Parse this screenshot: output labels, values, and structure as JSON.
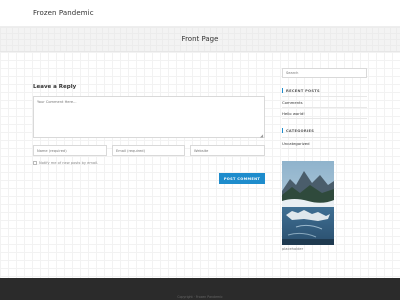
{
  "header": {
    "site_title": "Frozen Pandemic"
  },
  "hero": {
    "page_title": "Front Page"
  },
  "comment_form": {
    "title": "Leave a Reply",
    "comment_placeholder": "Your Comment Here...",
    "name_placeholder": "Name (required)",
    "email_placeholder": "Email (required)",
    "website_placeholder": "Website",
    "notify_label": "Notify me of new posts by email.",
    "submit_label": "POST COMMENT"
  },
  "sidebar": {
    "search_placeholder": "Search",
    "recent_posts": {
      "title": "RECENT POSTS",
      "items": [
        "Comments",
        "Hello world!"
      ]
    },
    "categories": {
      "title": "CATEGORIES",
      "items": [
        "Uncategorized"
      ]
    },
    "image_caption": "placeholder"
  },
  "footer": {
    "copyright": "Copyright · Frozen Pandemic"
  },
  "colors": {
    "accent": "#1e8ccc",
    "footer_bg": "#2b2b2b"
  }
}
